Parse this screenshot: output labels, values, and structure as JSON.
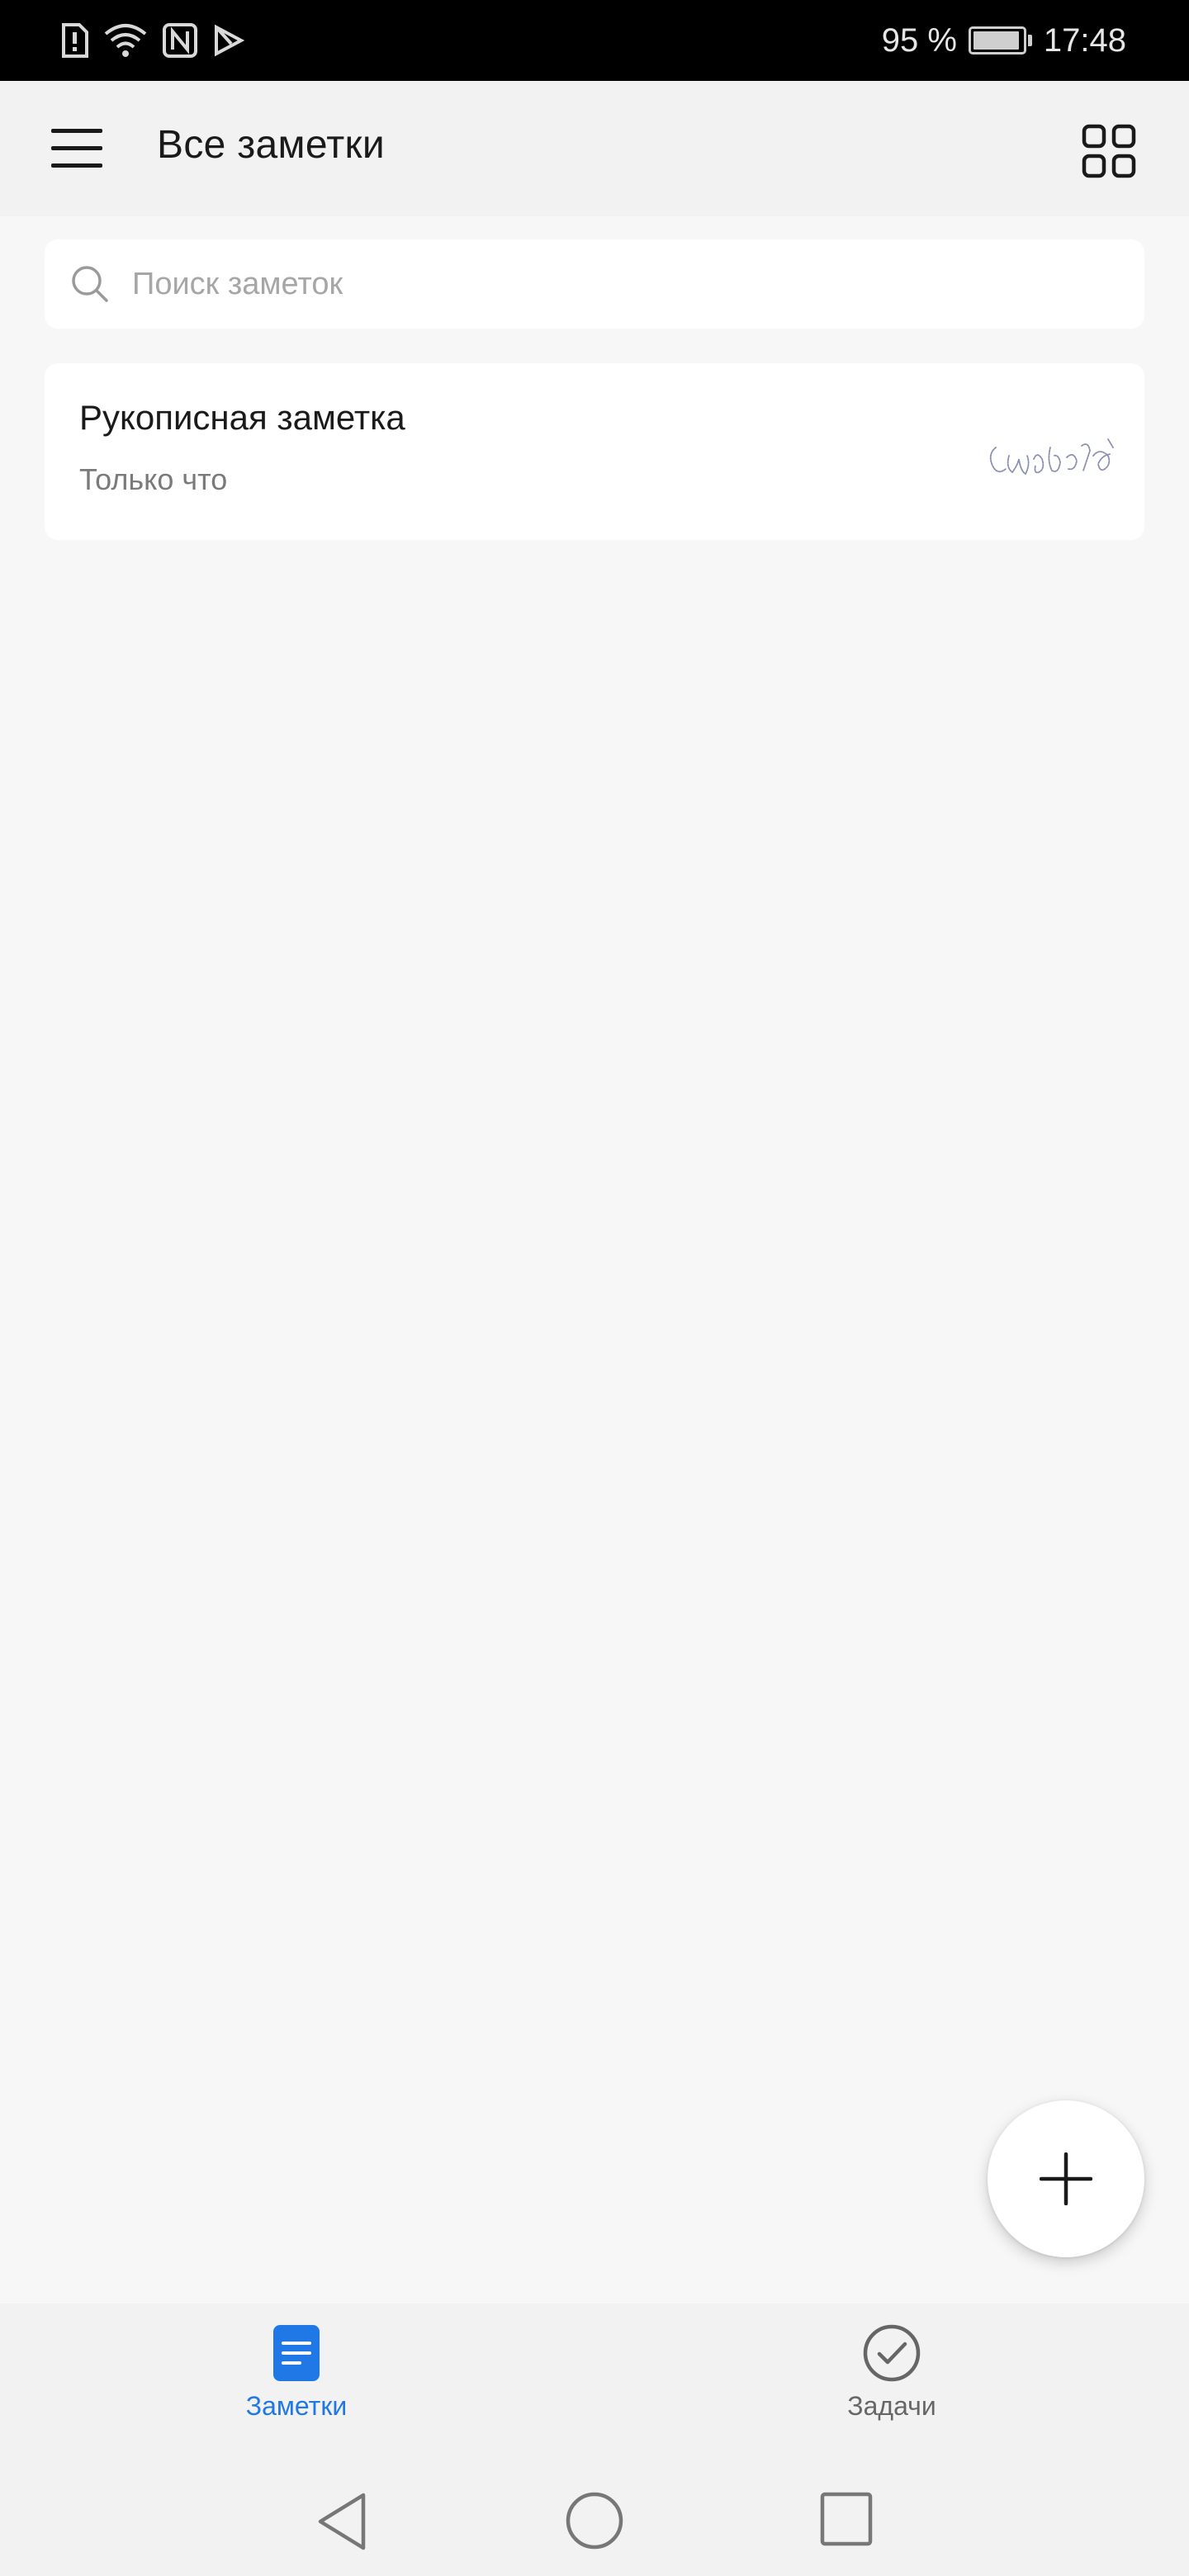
{
  "status_bar": {
    "battery_text": "95 %",
    "battery_level": 0.95,
    "time": "17:48",
    "icons": [
      "sim-alert-icon",
      "wifi-icon",
      "nfc-icon",
      "play-store-icon"
    ]
  },
  "app_bar": {
    "title": "Все заметки",
    "menu_icon": "menu-icon",
    "view_toggle_icon": "grid-view-icon"
  },
  "search": {
    "placeholder": "Поиск заметок",
    "value": "",
    "icon": "search-icon"
  },
  "notes": [
    {
      "title": "Рукописная заметка",
      "time": "Только что",
      "thumbnail": "handwriting-preview"
    }
  ],
  "fab": {
    "icon": "plus-icon"
  },
  "bottom_nav": {
    "tabs": [
      {
        "label": "Заметки",
        "icon": "notes-icon",
        "active": true
      },
      {
        "label": "Задачи",
        "icon": "tasks-check-icon",
        "active": false
      }
    ]
  },
  "system_nav": {
    "buttons": [
      "back-icon",
      "home-icon",
      "recent-apps-icon"
    ]
  },
  "colors": {
    "accent": "#1f78e6",
    "background": "#f7f7f7",
    "bar": "#f2f2f2",
    "card": "#ffffff"
  }
}
